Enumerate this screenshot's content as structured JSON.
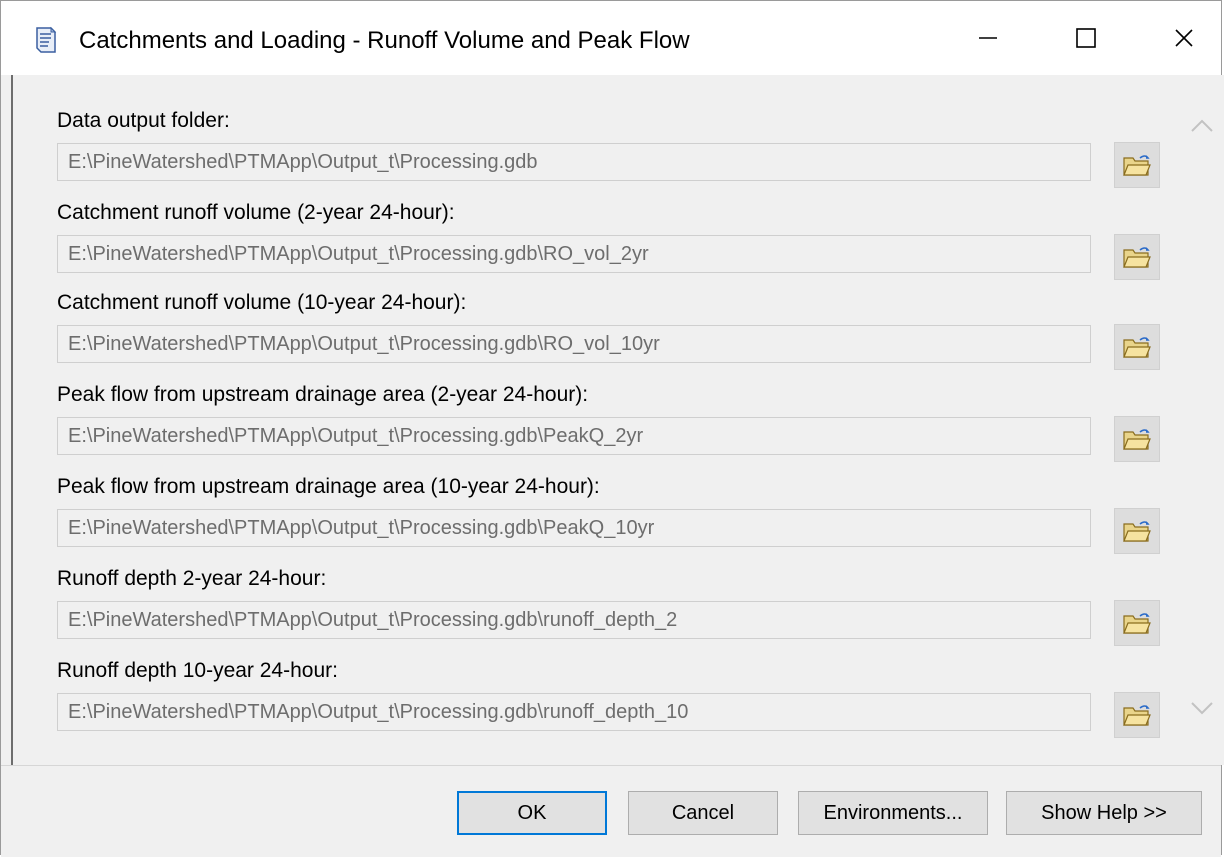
{
  "window": {
    "title": "Catchments and Loading - Runoff Volume and Peak Flow",
    "icon": "tool-script-icon",
    "controls": [
      "minimize-icon",
      "maximize-icon",
      "close-icon"
    ]
  },
  "parameters": [
    {
      "label": "Data output folder:",
      "value": "E:\\PineWatershed\\PTMApp\\Output_t\\Processing.gdb"
    },
    {
      "label": "Catchment runoff volume (2-year 24-hour):",
      "value": "E:\\PineWatershed\\PTMApp\\Output_t\\Processing.gdb\\RO_vol_2yr"
    },
    {
      "label": "Catchment runoff volume (10-year 24-hour):",
      "value": "E:\\PineWatershed\\PTMApp\\Output_t\\Processing.gdb\\RO_vol_10yr"
    },
    {
      "label": "Peak flow from upstream drainage area (2-year 24-hour):",
      "value": "E:\\PineWatershed\\PTMApp\\Output_t\\Processing.gdb\\PeakQ_2yr"
    },
    {
      "label": "Peak flow from upstream drainage area (10-year 24-hour):",
      "value": "E:\\PineWatershed\\PTMApp\\Output_t\\Processing.gdb\\PeakQ_10yr"
    },
    {
      "label": "Runoff depth 2-year 24-hour:",
      "value": "E:\\PineWatershed\\PTMApp\\Output_t\\Processing.gdb\\runoff_depth_2"
    },
    {
      "label": "Runoff depth 10-year 24-hour:",
      "value": "E:\\PineWatershed\\PTMApp\\Output_t\\Processing.gdb\\runoff_depth_10"
    }
  ],
  "buttons": {
    "ok": "OK",
    "cancel": "Cancel",
    "environments": "Environments...",
    "help": "Show Help >>"
  },
  "colors": {
    "accent": "#0078d7",
    "disabled_text": "#6d6d6d"
  }
}
